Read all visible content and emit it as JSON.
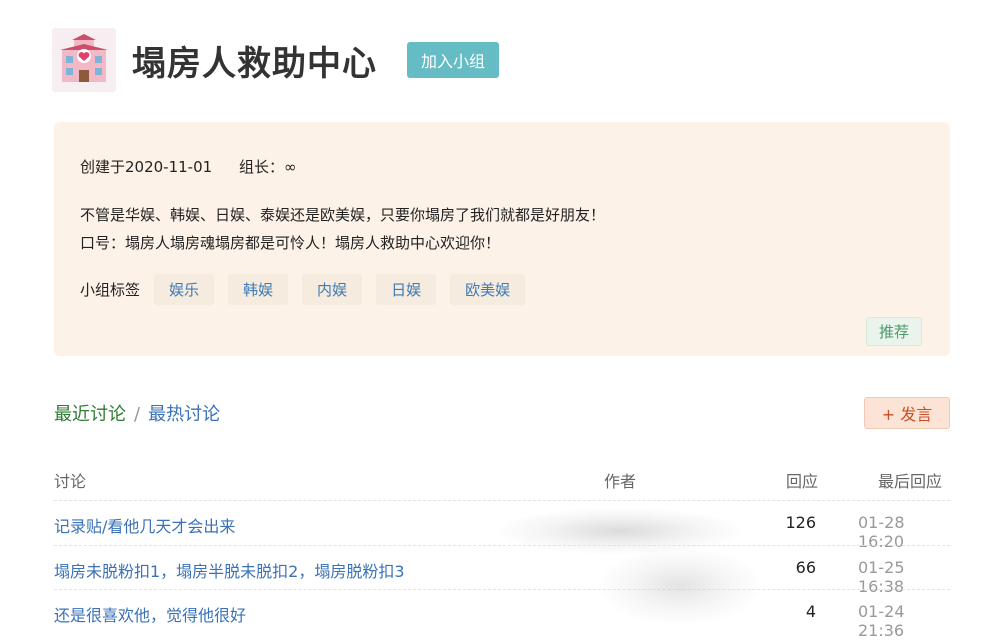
{
  "group": {
    "title": "塌房人救助中心",
    "join_label": "加入小组",
    "logo_icon": "pink-hospital-heart-icon"
  },
  "info": {
    "created": "创建于2020-11-01",
    "owner_label": "组长：",
    "owner_value": "∞",
    "desc_line1": "不管是华娱、韩娱、日娱、泰娱还是欧美娱，只要你塌房了我们就都是好朋友！",
    "desc_line2": "口号：塌房人塌房魂塌房都是可怜人！塌房人救助中心欢迎你！",
    "tags_label": "小组标签",
    "tags": [
      "娱乐",
      "韩娱",
      "内娱",
      "日娱",
      "欧美娱"
    ],
    "recommend_label": "推荐"
  },
  "discussions": {
    "tab_recent": "最近讨论",
    "tab_sep": "/",
    "tab_hot": "最热讨论",
    "post_label": "+ 发言",
    "columns": {
      "topic": "讨论",
      "author": "作者",
      "replies": "回应",
      "last": "最后回应"
    },
    "rows": [
      {
        "title": "记录贴/看他几天才会出来",
        "replies": "126",
        "last": "01-28 16:20"
      },
      {
        "title": "塌房未脱粉扣1，塌房半脱未脱扣2，塌房脱粉扣3",
        "replies": "66",
        "last": "01-25 16:38"
      },
      {
        "title": "还是很喜欢他，觉得他很好",
        "replies": "4",
        "last": "01-24 21:36"
      }
    ]
  },
  "colors": {
    "accent_teal": "#66bcc4",
    "info_bg": "#fdf2e8",
    "link_blue": "#3a72b8",
    "recent_green": "#2e7d32",
    "post_orange": "#c8512a"
  }
}
